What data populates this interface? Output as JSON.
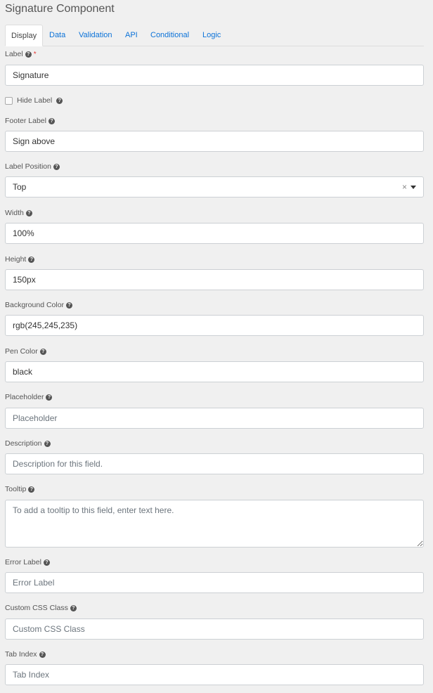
{
  "header": {
    "title": "Signature Component"
  },
  "tabs": [
    {
      "label": "Display",
      "active": true
    },
    {
      "label": "Data",
      "active": false
    },
    {
      "label": "Validation",
      "active": false
    },
    {
      "label": "API",
      "active": false
    },
    {
      "label": "Conditional",
      "active": false
    },
    {
      "label": "Logic",
      "active": false
    }
  ],
  "help_icon_glyph": "?",
  "required_marker": "*",
  "clear_glyph": "×",
  "fields": {
    "label": {
      "label": "Label",
      "value": "Signature"
    },
    "hide_label": {
      "label": "Hide Label",
      "checked": false
    },
    "footer_label": {
      "label": "Footer Label",
      "value": "Sign above"
    },
    "label_position": {
      "label": "Label Position",
      "value": "Top"
    },
    "width": {
      "label": "Width",
      "value": "100%"
    },
    "height": {
      "label": "Height",
      "value": "150px"
    },
    "background_color": {
      "label": "Background Color",
      "value": "rgb(245,245,235)"
    },
    "pen_color": {
      "label": "Pen Color",
      "value": "black"
    },
    "placeholder": {
      "label": "Placeholder",
      "placeholder": "Placeholder"
    },
    "description": {
      "label": "Description",
      "placeholder": "Description for this field."
    },
    "tooltip": {
      "label": "Tooltip",
      "placeholder": "To add a tooltip to this field, enter text here."
    },
    "error_label": {
      "label": "Error Label",
      "placeholder": "Error Label"
    },
    "custom_css_class": {
      "label": "Custom CSS Class",
      "placeholder": "Custom CSS Class"
    },
    "tab_index": {
      "label": "Tab Index",
      "placeholder": "Tab Index"
    }
  }
}
